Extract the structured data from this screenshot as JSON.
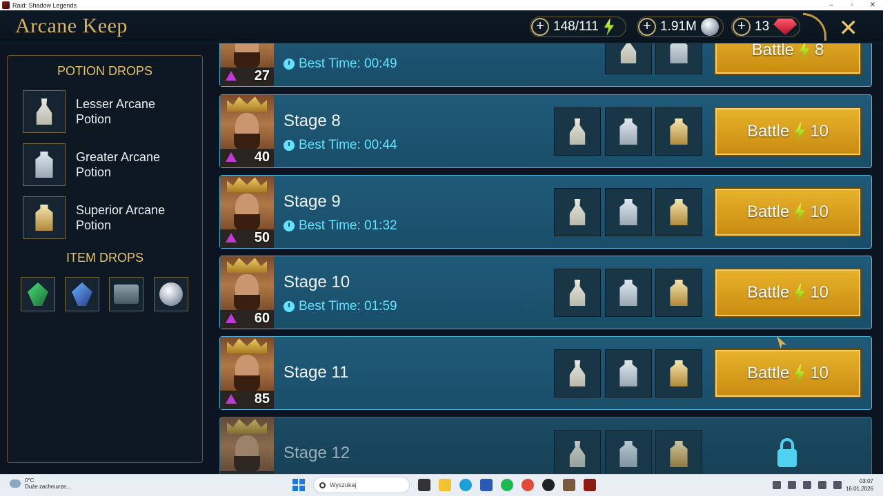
{
  "window": {
    "title": "Raid: Shadow Legends",
    "controls": [
      "–",
      "▫",
      "✕"
    ]
  },
  "header": {
    "title": "Arcane Keep",
    "resources": [
      {
        "value": "148/111",
        "icon": "energy-icon"
      },
      {
        "value": "1.91M",
        "icon": "silver-icon"
      },
      {
        "value": "13",
        "icon": "gem-icon"
      }
    ],
    "close_label": "✕"
  },
  "left_panel": {
    "potion_title": "POTION DROPS",
    "potions": [
      {
        "name": "Lesser Arcane Potion",
        "icon": "lesser-arcane-potion-icon"
      },
      {
        "name": "Greater Arcane Potion",
        "icon": "greater-arcane-potion-icon"
      },
      {
        "name": "Superior Arcane Potion",
        "icon": "superior-arcane-potion-icon"
      }
    ],
    "item_title": "ITEM DROPS",
    "items": [
      "artifact-icon",
      "accessory-icon",
      "chest-icon",
      "silver-coin-icon"
    ]
  },
  "stages": [
    {
      "name": "",
      "level": "27",
      "best_time": "Best Time: 00:49",
      "battle_label": "Battle",
      "energy_cost": "8",
      "locked": false
    },
    {
      "name": "Stage 8",
      "level": "40",
      "best_time": "Best Time: 00:44",
      "battle_label": "Battle",
      "energy_cost": "10",
      "locked": false
    },
    {
      "name": "Stage 9",
      "level": "50",
      "best_time": "Best Time: 01:32",
      "battle_label": "Battle",
      "energy_cost": "10",
      "locked": false
    },
    {
      "name": "Stage 10",
      "level": "60",
      "best_time": "Best Time: 01:59",
      "battle_label": "Battle",
      "energy_cost": "10",
      "locked": false
    },
    {
      "name": "Stage 11",
      "level": "85",
      "best_time": "",
      "battle_label": "Battle",
      "energy_cost": "10",
      "locked": false
    },
    {
      "name": "Stage 12",
      "level": "",
      "best_time": "",
      "battle_label": "",
      "energy_cost": "",
      "locked": true
    }
  ],
  "taskbar": {
    "weather_temp": "0°C",
    "weather_desc": "Duże zachmurze...",
    "search_placeholder": "Wyszukaj",
    "time": "03:07",
    "date": "16.01.2026"
  }
}
